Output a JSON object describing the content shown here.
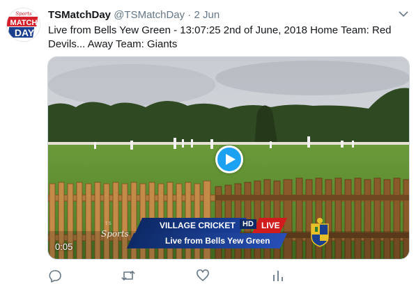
{
  "tweet": {
    "avatar_text_top": "Sports",
    "avatar_text_mid": "MATCH",
    "avatar_text_bottom": "DAY",
    "display_name": "TSMatchDay",
    "handle": "@TSMatchDay",
    "separator": "·",
    "time": "2 Jun",
    "text": "Live from Bells Yew Green - 13:07:25 2nd of June, 2018  Home Team: Red Devils... Away Team: Giants"
  },
  "video": {
    "duration": "0:05",
    "watermark_small": "TS",
    "watermark": "Sports",
    "banner_title": "VILLAGE CRICKET",
    "banner_hd": "HD",
    "banner_live": "LIVE",
    "banner_subtitle": "Live from Bells Yew Green"
  },
  "actions": {
    "icons": [
      "reply-icon",
      "retweet-icon",
      "like-icon",
      "analytics-icon"
    ]
  },
  "colors": {
    "accent": "#1da1f2",
    "text": "#14171a",
    "muted": "#657786",
    "live": "#d01c1c",
    "banner": "#0d2a66"
  }
}
